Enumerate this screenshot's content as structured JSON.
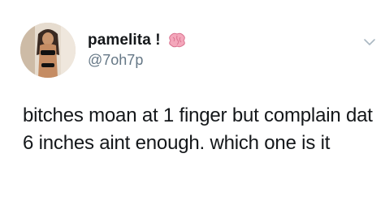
{
  "tweet": {
    "author": {
      "display_name": "pamelita !",
      "handle": "@7oh7p",
      "name_emoji": "brain-emoji"
    },
    "menu_icon": "chevron-down-icon",
    "text": "bitches moan at 1 finger but complain dat 6 inches aint enough. which one is it"
  }
}
